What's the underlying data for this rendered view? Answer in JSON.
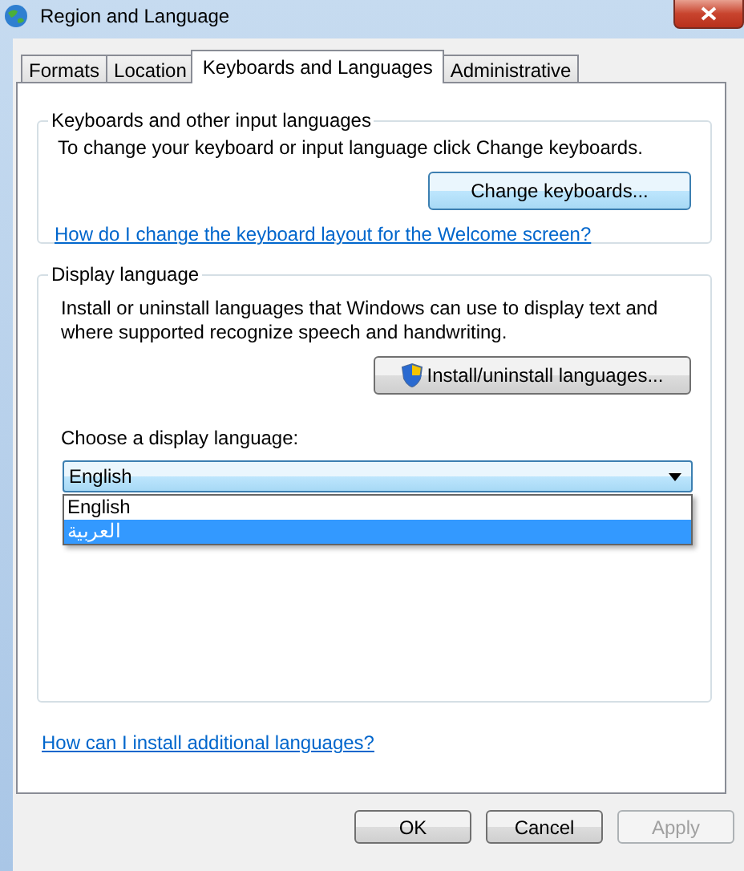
{
  "window": {
    "title": "Region and Language"
  },
  "tabs": [
    {
      "label": "Formats",
      "selected": false
    },
    {
      "label": "Location",
      "selected": false
    },
    {
      "label": "Keyboards and Languages",
      "selected": true
    },
    {
      "label": "Administrative",
      "selected": false
    }
  ],
  "keyboards_group": {
    "title": "Keyboards and other input languages",
    "description": "To change your keyboard or input language click Change keyboards.",
    "button": "Change keyboards...",
    "link": "How do I change the keyboard layout for the Welcome screen?"
  },
  "display_group": {
    "title": "Display language",
    "description": "Install or uninstall languages that Windows can use to display text and where supported recognize speech and handwriting.",
    "button": "Install/uninstall languages...",
    "combo_label": "Choose a display language:",
    "combo": {
      "value": "English",
      "expanded": true,
      "options": [
        {
          "label": "English",
          "highlighted": false
        },
        {
          "label": "العربية",
          "highlighted": true
        }
      ]
    }
  },
  "link": "How can I install additional languages?",
  "buttons": [
    {
      "label": "OK",
      "disabled": false
    },
    {
      "label": "Cancel",
      "disabled": false
    },
    {
      "label": "Apply",
      "disabled": true
    }
  ]
}
